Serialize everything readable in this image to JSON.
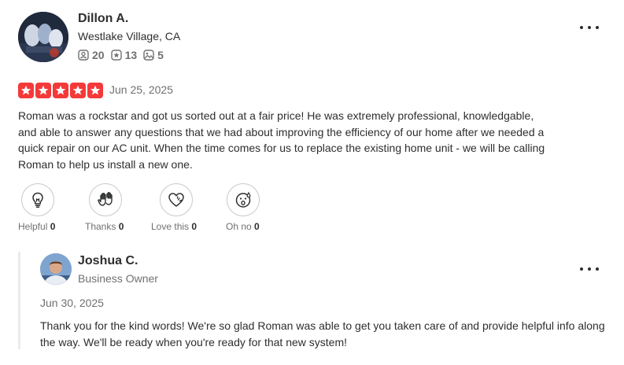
{
  "review": {
    "reviewer": {
      "name": "Dillon A.",
      "location": "Westlake Village, CA",
      "stats": {
        "friends": "20",
        "reviews": "13",
        "photos": "5"
      }
    },
    "rating": 5,
    "date": "Jun 25, 2025",
    "text": "Roman was a rockstar and got us sorted out at a fair price! He was extremely professional, knowledgable, and able to answer any questions that we had about improving the efficiency of our home after we needed a quick repair on our AC unit. When the time comes for us to replace the existing home unit - we will be calling Roman to help us install a new one.",
    "reactions": [
      {
        "label": "Helpful",
        "count": "0",
        "icon": "lightbulb-icon"
      },
      {
        "label": "Thanks",
        "count": "0",
        "icon": "high-five-icon"
      },
      {
        "label": "Love this",
        "count": "0",
        "icon": "heart-icon"
      },
      {
        "label": "Oh no",
        "count": "0",
        "icon": "oh-no-face-icon"
      }
    ]
  },
  "reply": {
    "name": "Joshua C.",
    "role": "Business Owner",
    "date": "Jun 30, 2025",
    "text": "Thank you for the kind words! We're so glad Roman was able to get you taken care of and provide helpful info along the way. We'll be ready when you're ready for that new system!"
  },
  "colors": {
    "star": "#f43939",
    "text": "#2d2e2f",
    "muted": "#6e7072",
    "border": "#c8c9ca"
  }
}
